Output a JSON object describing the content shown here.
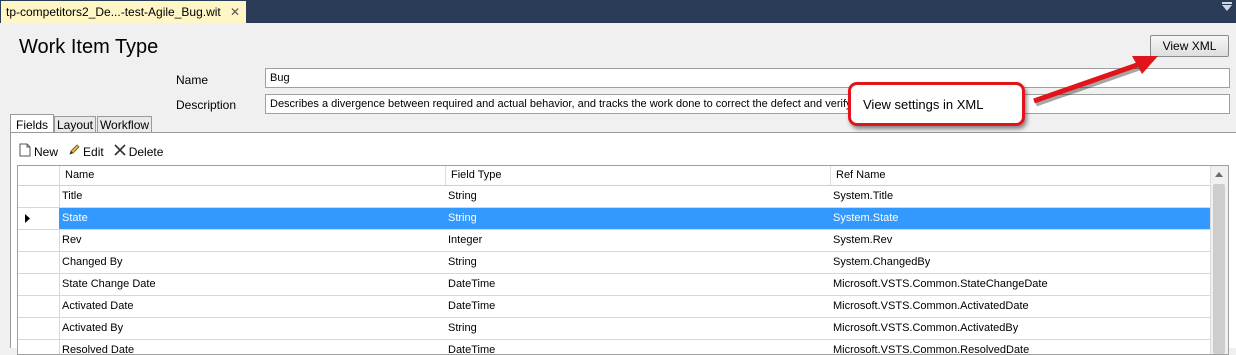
{
  "document_tab": {
    "title": "tp-competitors2_De...-test-Agile_Bug.wit",
    "close_glyph": "✕"
  },
  "header": {
    "title": "Work Item Type",
    "view_xml_label": "View XML"
  },
  "form": {
    "name_label": "Name",
    "name_value": "Bug",
    "description_label": "Description",
    "description_value": "Describes a divergence between required and actual behavior, and tracks the work done to correct the defect and verify th"
  },
  "tabs": [
    {
      "label": "Fields",
      "active": true
    },
    {
      "label": "Layout",
      "active": false
    },
    {
      "label": "Workflow",
      "active": false
    }
  ],
  "toolbar": {
    "new_label": "New",
    "edit_label": "Edit",
    "delete_label": "Delete"
  },
  "grid": {
    "columns": [
      "Name",
      "Field Type",
      "Ref Name"
    ],
    "rows": [
      {
        "name": "Title",
        "type": "String",
        "ref": "System.Title"
      },
      {
        "name": "State",
        "type": "String",
        "ref": "System.State"
      },
      {
        "name": "Rev",
        "type": "Integer",
        "ref": "System.Rev"
      },
      {
        "name": "Changed By",
        "type": "String",
        "ref": "System.ChangedBy"
      },
      {
        "name": "State Change Date",
        "type": "DateTime",
        "ref": "Microsoft.VSTS.Common.StateChangeDate"
      },
      {
        "name": "Activated Date",
        "type": "DateTime",
        "ref": "Microsoft.VSTS.Common.ActivatedDate"
      },
      {
        "name": "Activated By",
        "type": "String",
        "ref": "Microsoft.VSTS.Common.ActivatedBy"
      },
      {
        "name": "Resolved Date",
        "type": "DateTime",
        "ref": "Microsoft.VSTS.Common.ResolvedDate"
      }
    ],
    "selected_index": 1
  },
  "callout": {
    "text": "View settings in XML"
  },
  "colors": {
    "selection": "#3399ff",
    "callout_border": "#e1141b",
    "tab_active_bg": "#fff6c6",
    "tabstrip_bg": "#2b3c59"
  }
}
